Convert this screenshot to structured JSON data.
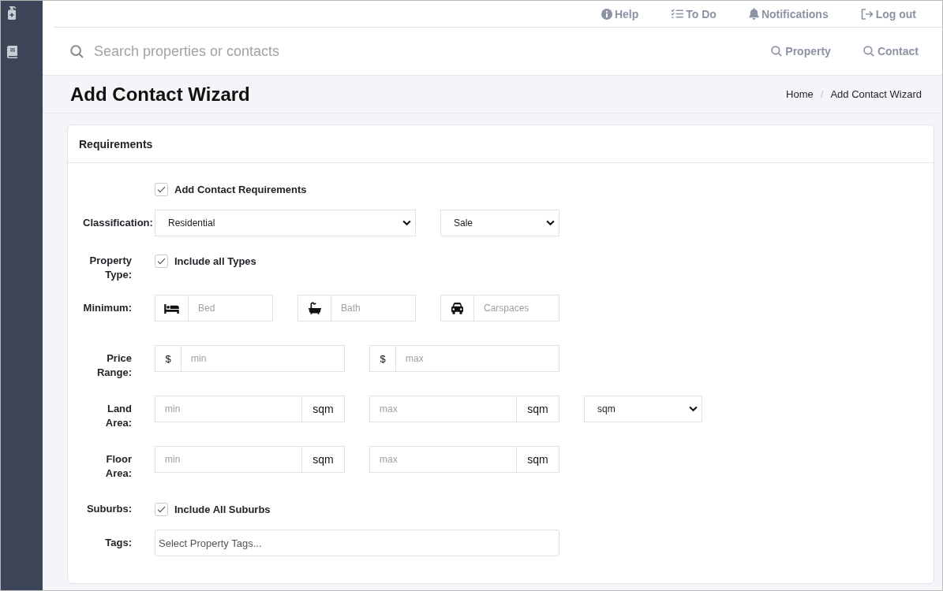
{
  "top_nav": {
    "links": [
      {
        "label": "Help"
      },
      {
        "label": "To Do"
      },
      {
        "label": "Notifications"
      },
      {
        "label": "Log out"
      }
    ]
  },
  "search_bar": {
    "placeholder": "Search properties or contacts",
    "scopes": [
      {
        "label": "Property"
      },
      {
        "label": "Contact"
      }
    ]
  },
  "page_header": {
    "title": "Add Contact Wizard",
    "breadcrumb": {
      "items": [
        "Home",
        "Add Contact Wizard"
      ],
      "separator": "/"
    }
  },
  "requirements_card": {
    "title": "Requirements",
    "rows": [
      {
        "kind": "checkbox",
        "checkbox": {
          "label": "Add Contact Requirements",
          "checked": true
        }
      },
      {
        "kind": "selects",
        "label": "Classification:",
        "selects": [
          {
            "value": "Residential"
          },
          {
            "value": "Sale"
          }
        ]
      },
      {
        "kind": "checkbox",
        "label": "Property Type:",
        "checkbox": {
          "label": "Include all Types",
          "checked": true
        }
      },
      {
        "kind": "icon_inputs",
        "label": "Minimum:",
        "inputs": [
          {
            "placeholder": "Bed"
          },
          {
            "placeholder": "Bath"
          },
          {
            "placeholder": "Carspaces"
          }
        ]
      },
      {
        "kind": "prefix_inputs",
        "label": "Price Range:",
        "inputs": [
          {
            "prefix": "$",
            "placeholder": "min"
          },
          {
            "prefix": "$",
            "placeholder": "max"
          }
        ]
      },
      {
        "kind": "suffix_inputs",
        "label": "Land Area:",
        "inputs": [
          {
            "placeholder": "min",
            "suffix": "sqm"
          },
          {
            "placeholder": "max",
            "suffix": "sqm"
          }
        ],
        "unit_select": {
          "value": "sqm"
        }
      },
      {
        "kind": "suffix_inputs",
        "label": "Floor Area:",
        "inputs": [
          {
            "placeholder": "min",
            "suffix": "sqm"
          },
          {
            "placeholder": "max",
            "suffix": "sqm"
          }
        ]
      },
      {
        "kind": "checkbox",
        "label": "Suburbs:",
        "checkbox": {
          "label": "Include All Suburbs",
          "checked": true
        }
      },
      {
        "kind": "tags",
        "label": "Tags:",
        "placeholder": "Select Property Tags..."
      }
    ]
  }
}
